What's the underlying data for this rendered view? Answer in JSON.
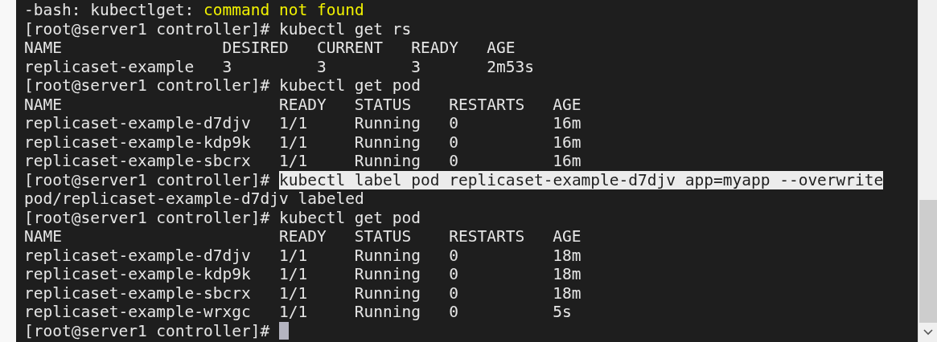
{
  "terminal": {
    "lines": [
      {
        "kind": "error",
        "prefix": "-bash: kubectlget: ",
        "message": "command not found"
      },
      {
        "kind": "prompt",
        "prompt": "[root@server1 controller]#",
        "command": "kubectl get rs",
        "highlighted": false,
        "cursor": false
      },
      {
        "kind": "table",
        "columns": [
          "NAME",
          "DESIRED",
          "CURRENT",
          "READY",
          "AGE"
        ],
        "rows": [
          [
            "replicaset-example",
            "3",
            "3",
            "3",
            "2m53s"
          ]
        ]
      },
      {
        "kind": "prompt",
        "prompt": "[root@server1 controller]#",
        "command": "kubectl get pod",
        "highlighted": false,
        "cursor": false
      },
      {
        "kind": "table",
        "columns": [
          "NAME",
          "READY",
          "STATUS",
          "RESTARTS",
          "AGE"
        ],
        "rows": [
          [
            "replicaset-example-d7djv",
            "1/1",
            "Running",
            "0",
            "16m"
          ],
          [
            "replicaset-example-kdp9k",
            "1/1",
            "Running",
            "0",
            "16m"
          ],
          [
            "replicaset-example-sbcrx",
            "1/1",
            "Running",
            "0",
            "16m"
          ]
        ]
      },
      {
        "kind": "prompt",
        "prompt": "[root@server1 controller]#",
        "command": "kubectl label pod replicaset-example-d7djv app=myapp --overwrite",
        "highlighted": true,
        "cursor": false
      },
      {
        "kind": "output",
        "text": "pod/replicaset-example-d7djv labeled"
      },
      {
        "kind": "prompt",
        "prompt": "[root@server1 controller]#",
        "command": "kubectl get pod",
        "highlighted": false,
        "cursor": false
      },
      {
        "kind": "table",
        "columns": [
          "NAME",
          "READY",
          "STATUS",
          "RESTARTS",
          "AGE"
        ],
        "rows": [
          [
            "replicaset-example-d7djv",
            "1/1",
            "Running",
            "0",
            "18m"
          ],
          [
            "replicaset-example-kdp9k",
            "1/1",
            "Running",
            "0",
            "18m"
          ],
          [
            "replicaset-example-sbcrx",
            "1/1",
            "Running",
            "0",
            "18m"
          ],
          [
            "replicaset-example-wrxgc",
            "1/1",
            "Running",
            "0",
            "5s"
          ]
        ]
      },
      {
        "kind": "prompt",
        "prompt": "[root@server1 controller]#",
        "highlighted": false,
        "cursor": true
      }
    ]
  }
}
